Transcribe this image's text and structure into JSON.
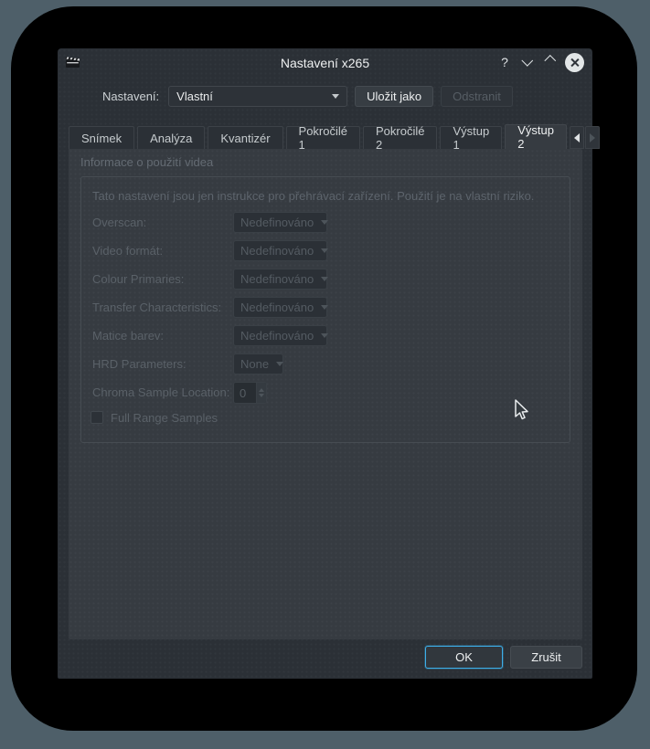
{
  "window": {
    "title": "Nastavení x265",
    "help_glyph": "?"
  },
  "preset": {
    "label": "Nastavení:",
    "value": "Vlastní",
    "save_as_button": "Uložit jako",
    "remove_button": "Odstranit"
  },
  "tabs": {
    "items": [
      {
        "label": "Snímek",
        "active": false
      },
      {
        "label": "Analýza",
        "active": false
      },
      {
        "label": "Kvantizér",
        "active": false
      },
      {
        "label": "Pokročilé 1",
        "active": false
      },
      {
        "label": "Pokročilé 2",
        "active": false
      },
      {
        "label": "Výstup 1",
        "active": false
      },
      {
        "label": "Výstup 2",
        "active": true
      }
    ]
  },
  "panel": {
    "group_title": "Informace o použití videa",
    "note": "Tato nastavení jsou jen instrukce pro přehrávací zařízení. Použití je na vlastní riziko.",
    "rows": [
      {
        "label": "Overscan:",
        "value": "Nedefinováno",
        "type": "select",
        "enabled": false
      },
      {
        "label": "Video formát:",
        "value": "Nedefinováno",
        "type": "select",
        "enabled": false
      },
      {
        "label": "Colour Primaries:",
        "value": "Nedefinováno",
        "type": "select",
        "enabled": false
      },
      {
        "label": "Transfer Characteristics:",
        "value": "Nedefinováno",
        "type": "select",
        "enabled": false
      },
      {
        "label": "Matice barev:",
        "value": "Nedefinováno",
        "type": "select",
        "enabled": false
      },
      {
        "label": "HRD Parameters:",
        "value": "None",
        "type": "select",
        "enabled": false
      },
      {
        "label": "Chroma Sample Location:",
        "value": "0",
        "type": "spinbox",
        "enabled": false
      }
    ],
    "checkbox": {
      "label": "Full Range Samples",
      "checked": false,
      "enabled": false
    }
  },
  "footer": {
    "ok_button": "OK",
    "cancel_button": "Zrušit"
  },
  "colors": {
    "accent": "#3daee9",
    "desktop": "#4e5f69",
    "dialog_bg": "#2b3036",
    "pane_bg": "#363b41",
    "disabled_text": "#5a6168",
    "shadow": "#000000",
    "close_button_bg": "#e2e6e7"
  }
}
